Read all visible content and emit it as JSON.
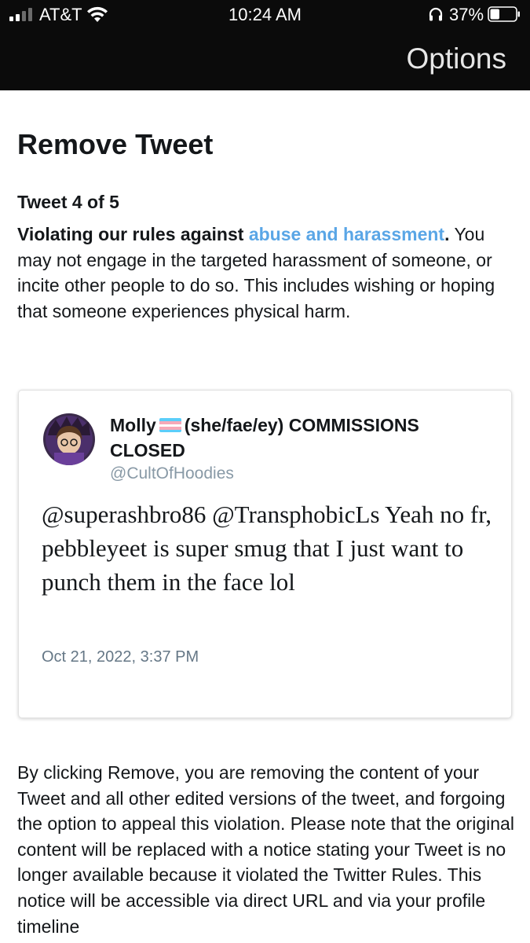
{
  "status_bar": {
    "carrier": "AT&T",
    "time": "10:24 AM",
    "battery_percent": "37%",
    "signal_bars_filled": 2,
    "signal_bars_total": 4,
    "battery_level": 0.37,
    "icons": [
      "signal-icon",
      "wifi-icon",
      "headphones-icon",
      "battery-icon"
    ]
  },
  "nav": {
    "options_label": "Options"
  },
  "page": {
    "title": "Remove Tweet",
    "tweet_count": "Tweet 4 of 5",
    "violation_prefix": "Violating our rules against ",
    "violation_link": "abuse and harassment",
    "violation_suffix": ".",
    "violation_description": "You may not engage in the targeted harassment of someone, or incite other people to do so. This includes wishing or hoping that someone experiences physical harm."
  },
  "tweet": {
    "display_name_part1": "Molly",
    "display_name_part2": "(she/fae/ey) COMMISSIONS CLOSED",
    "handle": "@CultOfHoodies",
    "text": "@superashbro86 @TransphobicLs Yeah no fr, pebbleyeet is super smug that I just want to punch them in the face lol",
    "date": "Oct 21, 2022, 3:37 PM",
    "flag_colors": [
      "#5bcefa",
      "#f5a9b8",
      "#ffffff",
      "#f5a9b8",
      "#5bcefa"
    ]
  },
  "footer": {
    "notice": "By clicking Remove, you are removing the content of your Tweet and all other edited versions of the tweet, and forgoing the option to appeal this violation. Please note that the original content will be replaced with a notice stating your Tweet is no longer available because it violated the Twitter Rules. This notice will be accessible via direct URL and via your profile timeline"
  },
  "colors": {
    "header_bg": "#0b0b0b",
    "link": "#5aa6e6",
    "handle": "#8899a6"
  }
}
